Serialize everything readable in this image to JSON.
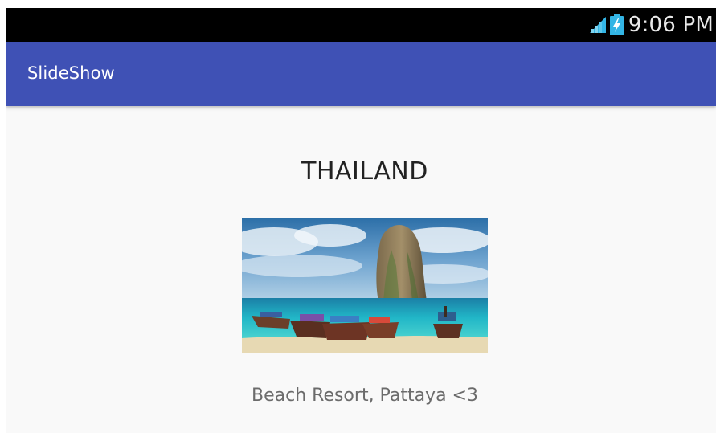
{
  "status_bar": {
    "time": "9:06 PM",
    "signal_icon": "signal-icon",
    "battery_icon": "battery-charging-icon"
  },
  "app_bar": {
    "title": "SlideShow",
    "color": "#3f51b5"
  },
  "slide": {
    "title": "THAILAND",
    "image_icon": "tropical-beach-longtail-boats-photo",
    "caption": "Beach Resort, Pattaya <3"
  }
}
